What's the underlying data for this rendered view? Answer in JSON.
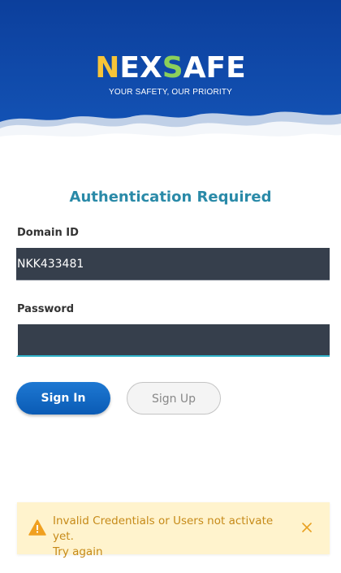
{
  "brand": {
    "logo_parts": [
      "N",
      "EX",
      "S",
      "AFE"
    ],
    "tagline": "YOUR SAFETY, OUR PRIORITY"
  },
  "auth": {
    "title": "Authentication Required",
    "domain_label": "Domain ID",
    "domain_value": "NKK433481",
    "password_label": "Password",
    "password_value": ""
  },
  "buttons": {
    "signin": "Sign In",
    "signup": "Sign Up"
  },
  "alert": {
    "line1": "Invalid Credentials or Users not activate yet.",
    "line2": "Try again",
    "icon": "warning-icon",
    "close_icon": "close-icon"
  },
  "colors": {
    "header_blue": "#0a47a8",
    "title": "#2a8aa8",
    "field_bg": "#363f4c",
    "primary_button": "#0a5bb5",
    "alert_bg": "#fff3cd",
    "alert_text": "#c68a18"
  }
}
